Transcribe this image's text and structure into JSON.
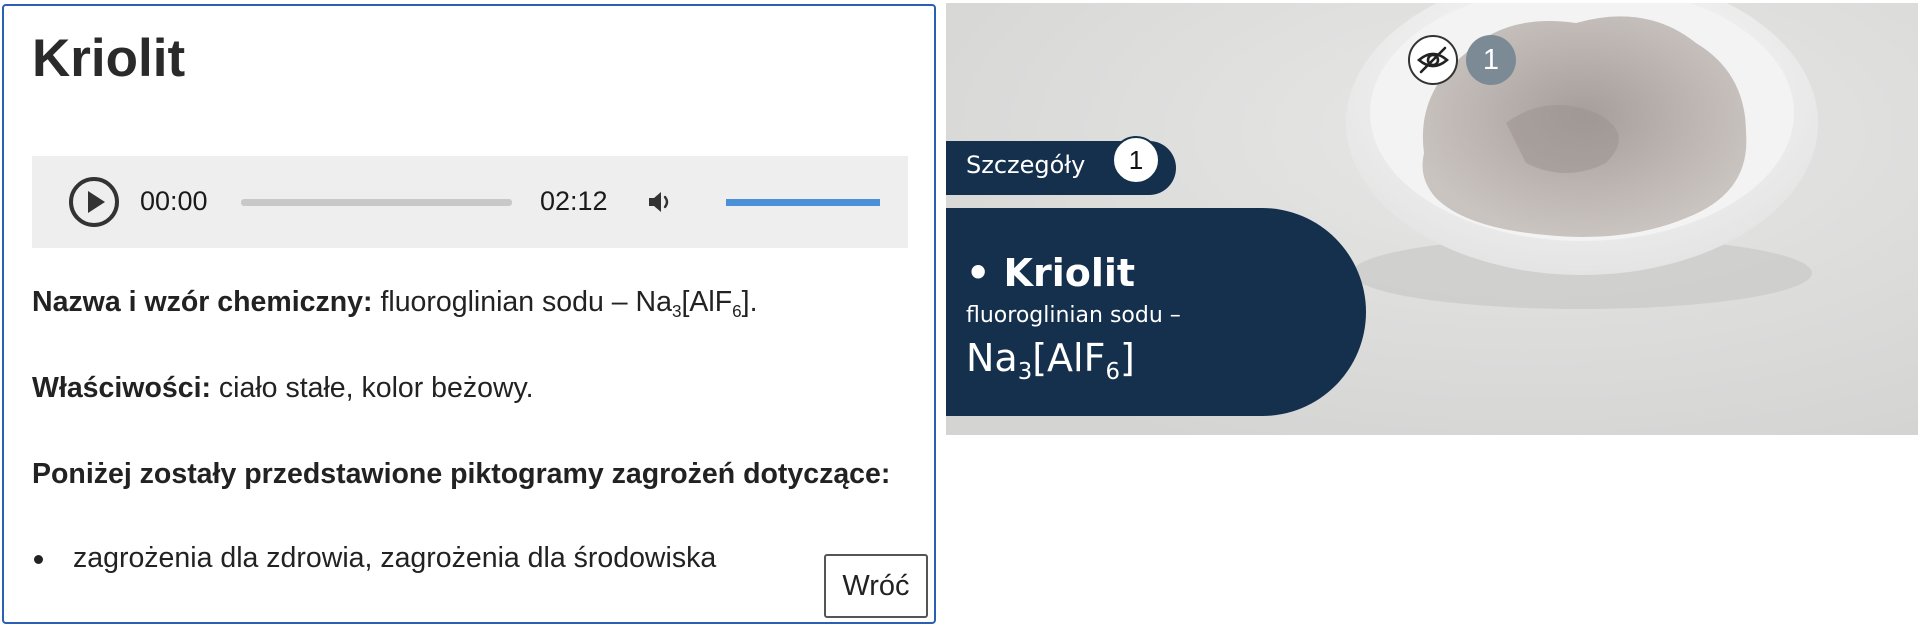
{
  "panel": {
    "title": "Kriolit",
    "audio": {
      "current_time": "00:00",
      "duration": "02:12",
      "progress": 0,
      "volume": 1.0
    },
    "name_label": "Nazwa i wzór chemiczny:",
    "name_value": "fluoroglinian sodu – Na",
    "name_sub1": "3",
    "name_mid": "[AlF",
    "name_sub2": "6",
    "name_end": "].",
    "props_label": "Właściwości:",
    "props_value": "ciało stałe, kolor beżowy.",
    "pictograms_heading": "Poniżej zostały przedstawione piktogramy zagrożeń dotyczące:",
    "hazards": [
      "zagrożenia dla zdrowia, zagrożenia dla środowiska"
    ],
    "back_button": "Wróć"
  },
  "illustration": {
    "badge_number": "1",
    "details_label": "Szczegóły",
    "details_number": "1",
    "card_name": "• Kriolit",
    "card_subtitle": "fluoroglinian sodu –",
    "card_formula_a": "Na",
    "card_formula_sub1": "3",
    "card_formula_b": "[AlF",
    "card_formula_sub2": "6",
    "card_formula_c": "]",
    "colors": {
      "card": "#14304d",
      "badge": "#7b8a94",
      "panel_border": "#2b5fb5",
      "volume": "#4a90d9"
    }
  }
}
